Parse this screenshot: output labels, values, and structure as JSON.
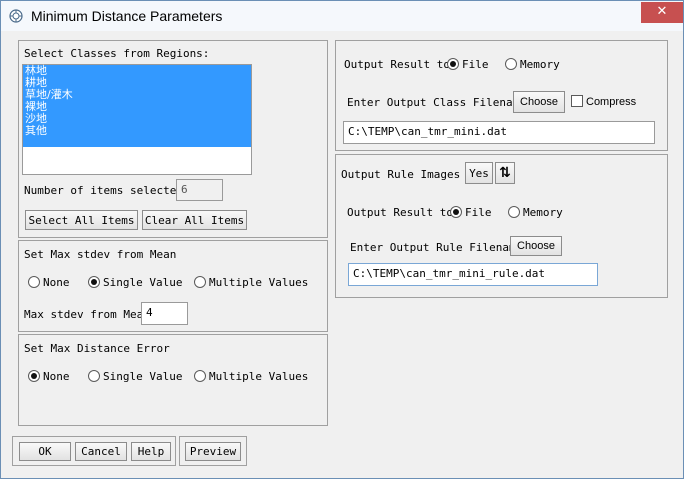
{
  "window": {
    "title": "Minimum Distance Parameters",
    "close_glyph": "✕"
  },
  "classes": {
    "heading": "Select Classes from Regions:",
    "items": [
      "林地",
      "耕地",
      "草地/灌木",
      "裸地",
      "沙地",
      "其他"
    ],
    "count_label": "Number of items selected:",
    "count_value": "6",
    "select_all": "Select All Items",
    "clear_all": "Clear All Items"
  },
  "stdev": {
    "heading": "Set Max stdev from Mean",
    "options": [
      "None",
      "Single Value",
      "Multiple Values"
    ],
    "selected": 1,
    "value_label": "Max stdev from Mean",
    "value": "4"
  },
  "distance": {
    "heading": "Set Max Distance Error",
    "options": [
      "None",
      "Single Value",
      "Multiple Values"
    ],
    "selected": 0
  },
  "buttons": {
    "ok": "OK",
    "cancel": "Cancel",
    "help": "Help",
    "preview": "Preview"
  },
  "output_class": {
    "label": "Output Result to",
    "options": [
      "File",
      "Memory"
    ],
    "selected": 0,
    "filename_label": "Enter Output Class Filename",
    "choose": "Choose",
    "compress": "Compress",
    "filename": "C:\\TEMP\\can_tmr_mini.dat"
  },
  "output_rule": {
    "images_label": "Output Rule Images ?",
    "images_value": "Yes",
    "toggle_glyph": "⇅",
    "label": "Output Result to",
    "options": [
      "File",
      "Memory"
    ],
    "selected": 0,
    "filename_label": "Enter Output Rule Filename",
    "choose": "Choose",
    "filename": "C:\\TEMP\\can_tmr_mini_rule.dat"
  }
}
